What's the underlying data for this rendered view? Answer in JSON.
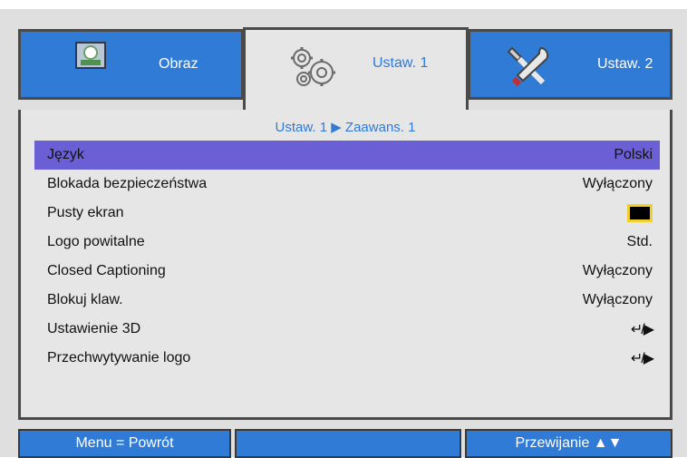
{
  "tabs": [
    {
      "label": "Obraz",
      "icon": "picture-icon"
    },
    {
      "label": "Ustaw. 1",
      "icon": "gears-icon"
    },
    {
      "label": "Ustaw. 2",
      "icon": "tools-icon"
    }
  ],
  "breadcrumb": "Ustaw. 1 ▶ Zaawans. 1",
  "rows": [
    {
      "label": "Język",
      "value": "Polski"
    },
    {
      "label": "Blokada bezpieczeństwa",
      "value": "Wyłączony"
    },
    {
      "label": "Pusty ekran",
      "value": ""
    },
    {
      "label": "Logo powitalne",
      "value": "Std."
    },
    {
      "label": "Closed Captioning",
      "value": "Wyłączony"
    },
    {
      "label": "Blokuj klaw.",
      "value": "Wyłączony"
    },
    {
      "label": "Ustawienie 3D",
      "value": "↵/▶"
    },
    {
      "label": "Przechwytywanie logo",
      "value": "↵/▶"
    }
  ],
  "footer": {
    "left": "Menu = Powrót",
    "middle": "",
    "right": "Przewijanie ▲▼"
  },
  "colors": {
    "accent": "#2f7bd6",
    "selected_row": "#6b5fd6",
    "blank_screen_swatch": "#000000",
    "swatch_border": "#f0d02a"
  }
}
